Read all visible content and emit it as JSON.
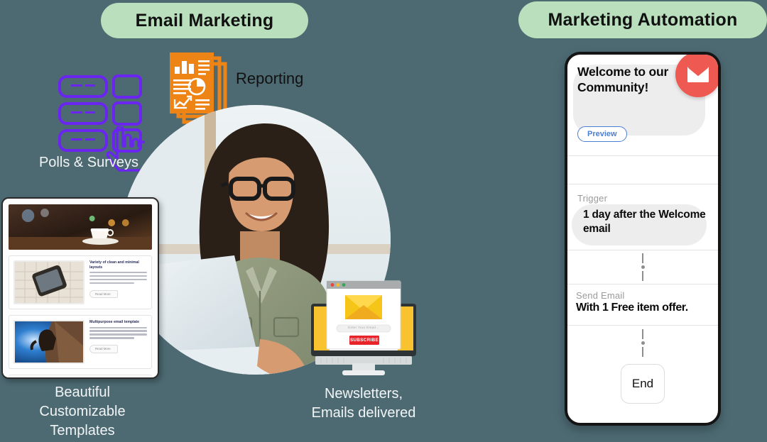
{
  "theme": {
    "background": "#4d6a73",
    "badge_bg": "#b9dfbc",
    "accent_purple": "#6a25f0",
    "accent_orange": "#ef8416",
    "accent_red": "#ee5a52",
    "accent_blue": "#4a7fd4",
    "subscribe_red": "#e8232a",
    "envelope_yellow": "#f5c518"
  },
  "headers": {
    "left_badge": "Email Marketing",
    "right_badge": "Marketing Automation"
  },
  "left_panel": {
    "polls": {
      "icon": "checklist-hand-icon",
      "label": "Polls & Surveys"
    },
    "reporting": {
      "icon": "report-document-icon",
      "label": "Reporting"
    },
    "templates": {
      "caption": "Beautiful\nCustomizable\nTemplates",
      "caption_lines": [
        "Beautiful",
        "Customizable",
        "Templates"
      ],
      "rows": [
        {
          "heading": "Variety of clean and minimal layouts",
          "button": "Read More",
          "thumb": "smartphone-on-keyboard-photo"
        },
        {
          "heading": "Multipurpose email template",
          "button": "Read More",
          "thumb": "rock-climber-photo"
        }
      ],
      "hero": "coffee-cup-cafe-photo"
    },
    "photo": {
      "alt": "woman-with-glasses-at-laptop-photo"
    }
  },
  "center": {
    "monitor": {
      "envelope_icon": "yellow-envelope-icon",
      "email_placeholder": "Enter Your Email...",
      "subscribe_label": "SUBSCRIBE"
    },
    "caption_lines": [
      "Newsletters,",
      "Emails  delivered"
    ]
  },
  "phone": {
    "welcome": {
      "title": "Welcome to our Community!",
      "preview_label": "Preview",
      "badge_icon": "envelope-icon"
    },
    "trigger": {
      "label": "Trigger",
      "value": "1 day after the Welcome email"
    },
    "send_email": {
      "label": "Send Email",
      "value": "With 1 Free item offer."
    },
    "end": {
      "label": "End"
    }
  }
}
